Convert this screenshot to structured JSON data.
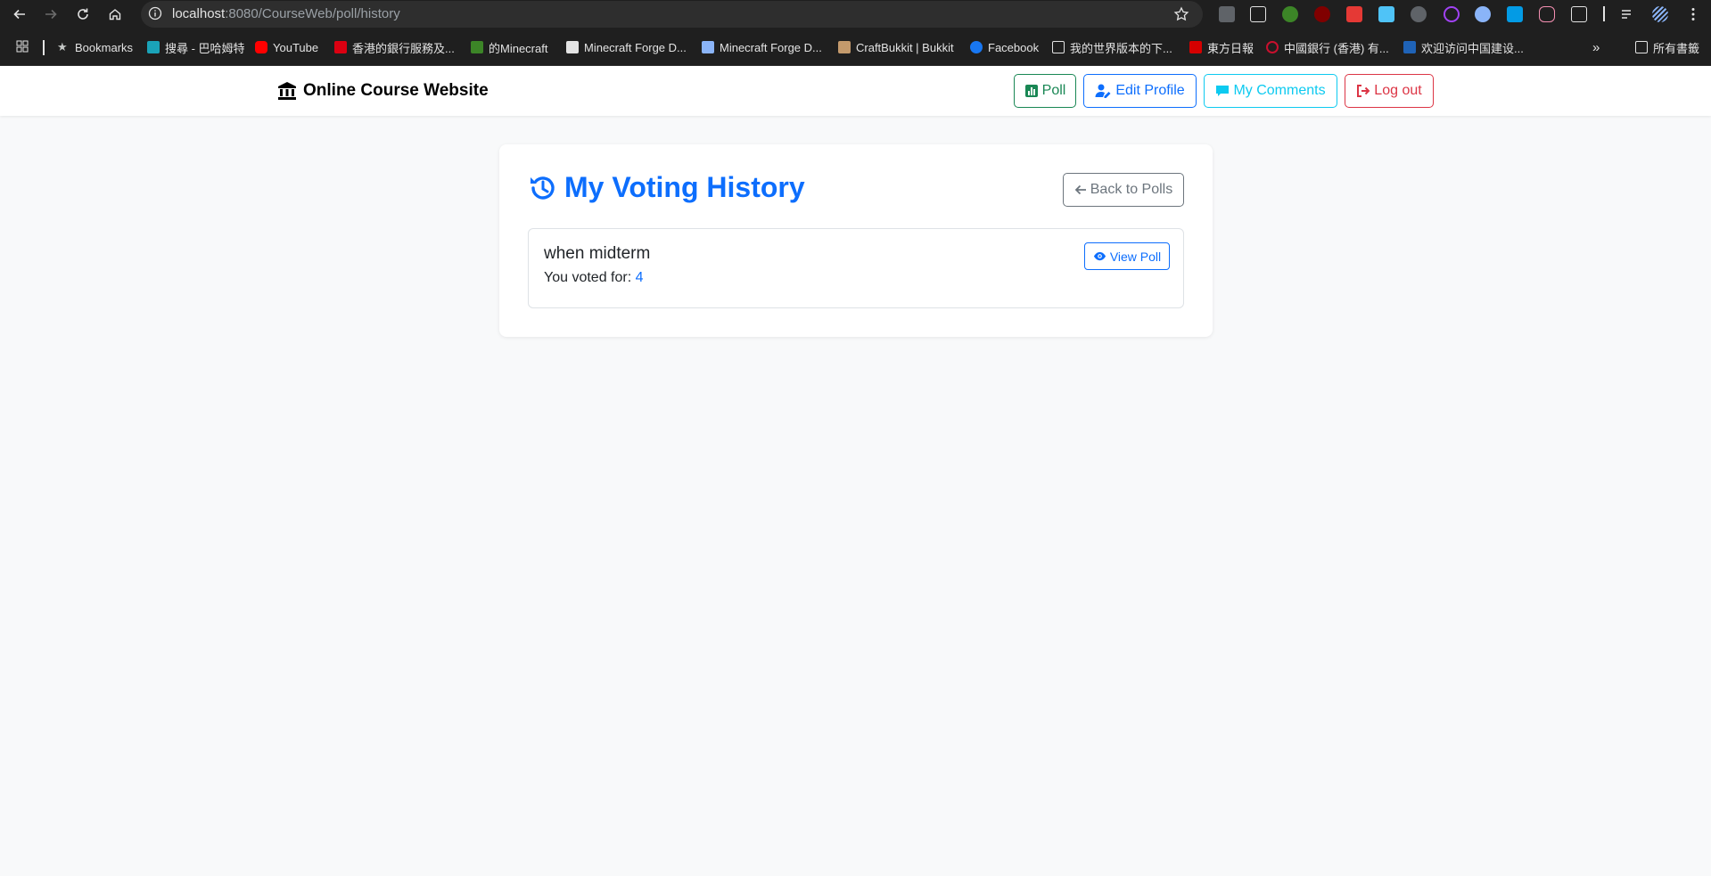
{
  "browser": {
    "url_host": "localhost",
    "url_rest": ":8080/CourseWeb/poll/history",
    "bookmarks": [
      {
        "label": "Bookmarks",
        "icon": "star-icon",
        "color": "#c4c7c5"
      },
      {
        "label": "搜尋 - 巴哈姆特",
        "icon": "bahamut-icon",
        "color": "#1aa3b8"
      },
      {
        "label": "YouTube",
        "icon": "youtube-icon",
        "color": "#ff0000"
      },
      {
        "label": "香港的銀行服務及...",
        "icon": "hsbc-icon",
        "color": "#db0011"
      },
      {
        "label": "的Minecraft",
        "icon": "minecraft-icon",
        "color": "#3c8527"
      },
      {
        "label": "Minecraft Forge D...",
        "icon": "forge-icon",
        "color": "#e3e3e3"
      },
      {
        "label": "Minecraft Forge D...",
        "icon": "forge-icon",
        "color": "#8ab4f8"
      },
      {
        "label": "CraftBukkit | Bukkit",
        "icon": "bukkit-icon",
        "color": "#c49a6c"
      },
      {
        "label": "Facebook",
        "icon": "facebook-icon",
        "color": "#1877f2"
      },
      {
        "label": "我的世界版本的下...",
        "icon": "image-icon",
        "color": "#e3e3e3"
      },
      {
        "label": "東方日報",
        "icon": "oriental-daily-icon",
        "color": "#d50000"
      },
      {
        "label": "中國銀行 (香港) 有...",
        "icon": "boc-icon",
        "color": "#c8102e"
      },
      {
        "label": "欢迎访问中国建设...",
        "icon": "ccb-icon",
        "color": "#1f63b7"
      }
    ],
    "all_bookmarks": "所有書籤"
  },
  "navbar": {
    "brand": "Online Course Website",
    "buttons": {
      "poll": "Poll",
      "edit_profile": "Edit Profile",
      "my_comments": "My Comments",
      "log_out": "Log out"
    }
  },
  "main": {
    "title": "My Voting History",
    "back_label": "Back to Polls",
    "history": [
      {
        "question": "when midterm",
        "voted_prefix": "You voted for:",
        "voted_value": "4",
        "view_label": "View Poll"
      }
    ]
  },
  "colors": {
    "primary": "#0d6efd",
    "success": "#198754",
    "info": "#0dcaf0",
    "danger": "#dc3545",
    "secondary": "#6c757d"
  }
}
